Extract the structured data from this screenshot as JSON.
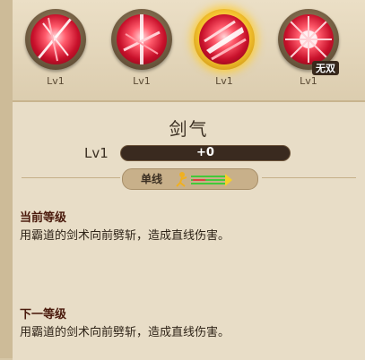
{
  "skills": [
    {
      "name": "skill-1",
      "level": "Lv1",
      "badge": ""
    },
    {
      "name": "skill-2",
      "level": "Lv1",
      "badge": ""
    },
    {
      "name": "skill-3",
      "level": "Lv1",
      "badge": "",
      "selected": true
    },
    {
      "name": "skill-4",
      "level": "Lv1",
      "badge": "无双"
    }
  ],
  "detail": {
    "title": "剑气",
    "level": "Lv1",
    "xp_text": "+0",
    "type": "单线",
    "current_heading": "当前等级",
    "current_desc": "用霸道的剑术向前劈斩，造成直线伤害。",
    "next_heading": "下一等级",
    "next_desc": "用霸道的剑术向前劈斩，造成直线伤害。"
  },
  "colors": {
    "orb": "#d61a36",
    "selected_ring": "#f4c22e",
    "panel": "#e8ddc7"
  }
}
